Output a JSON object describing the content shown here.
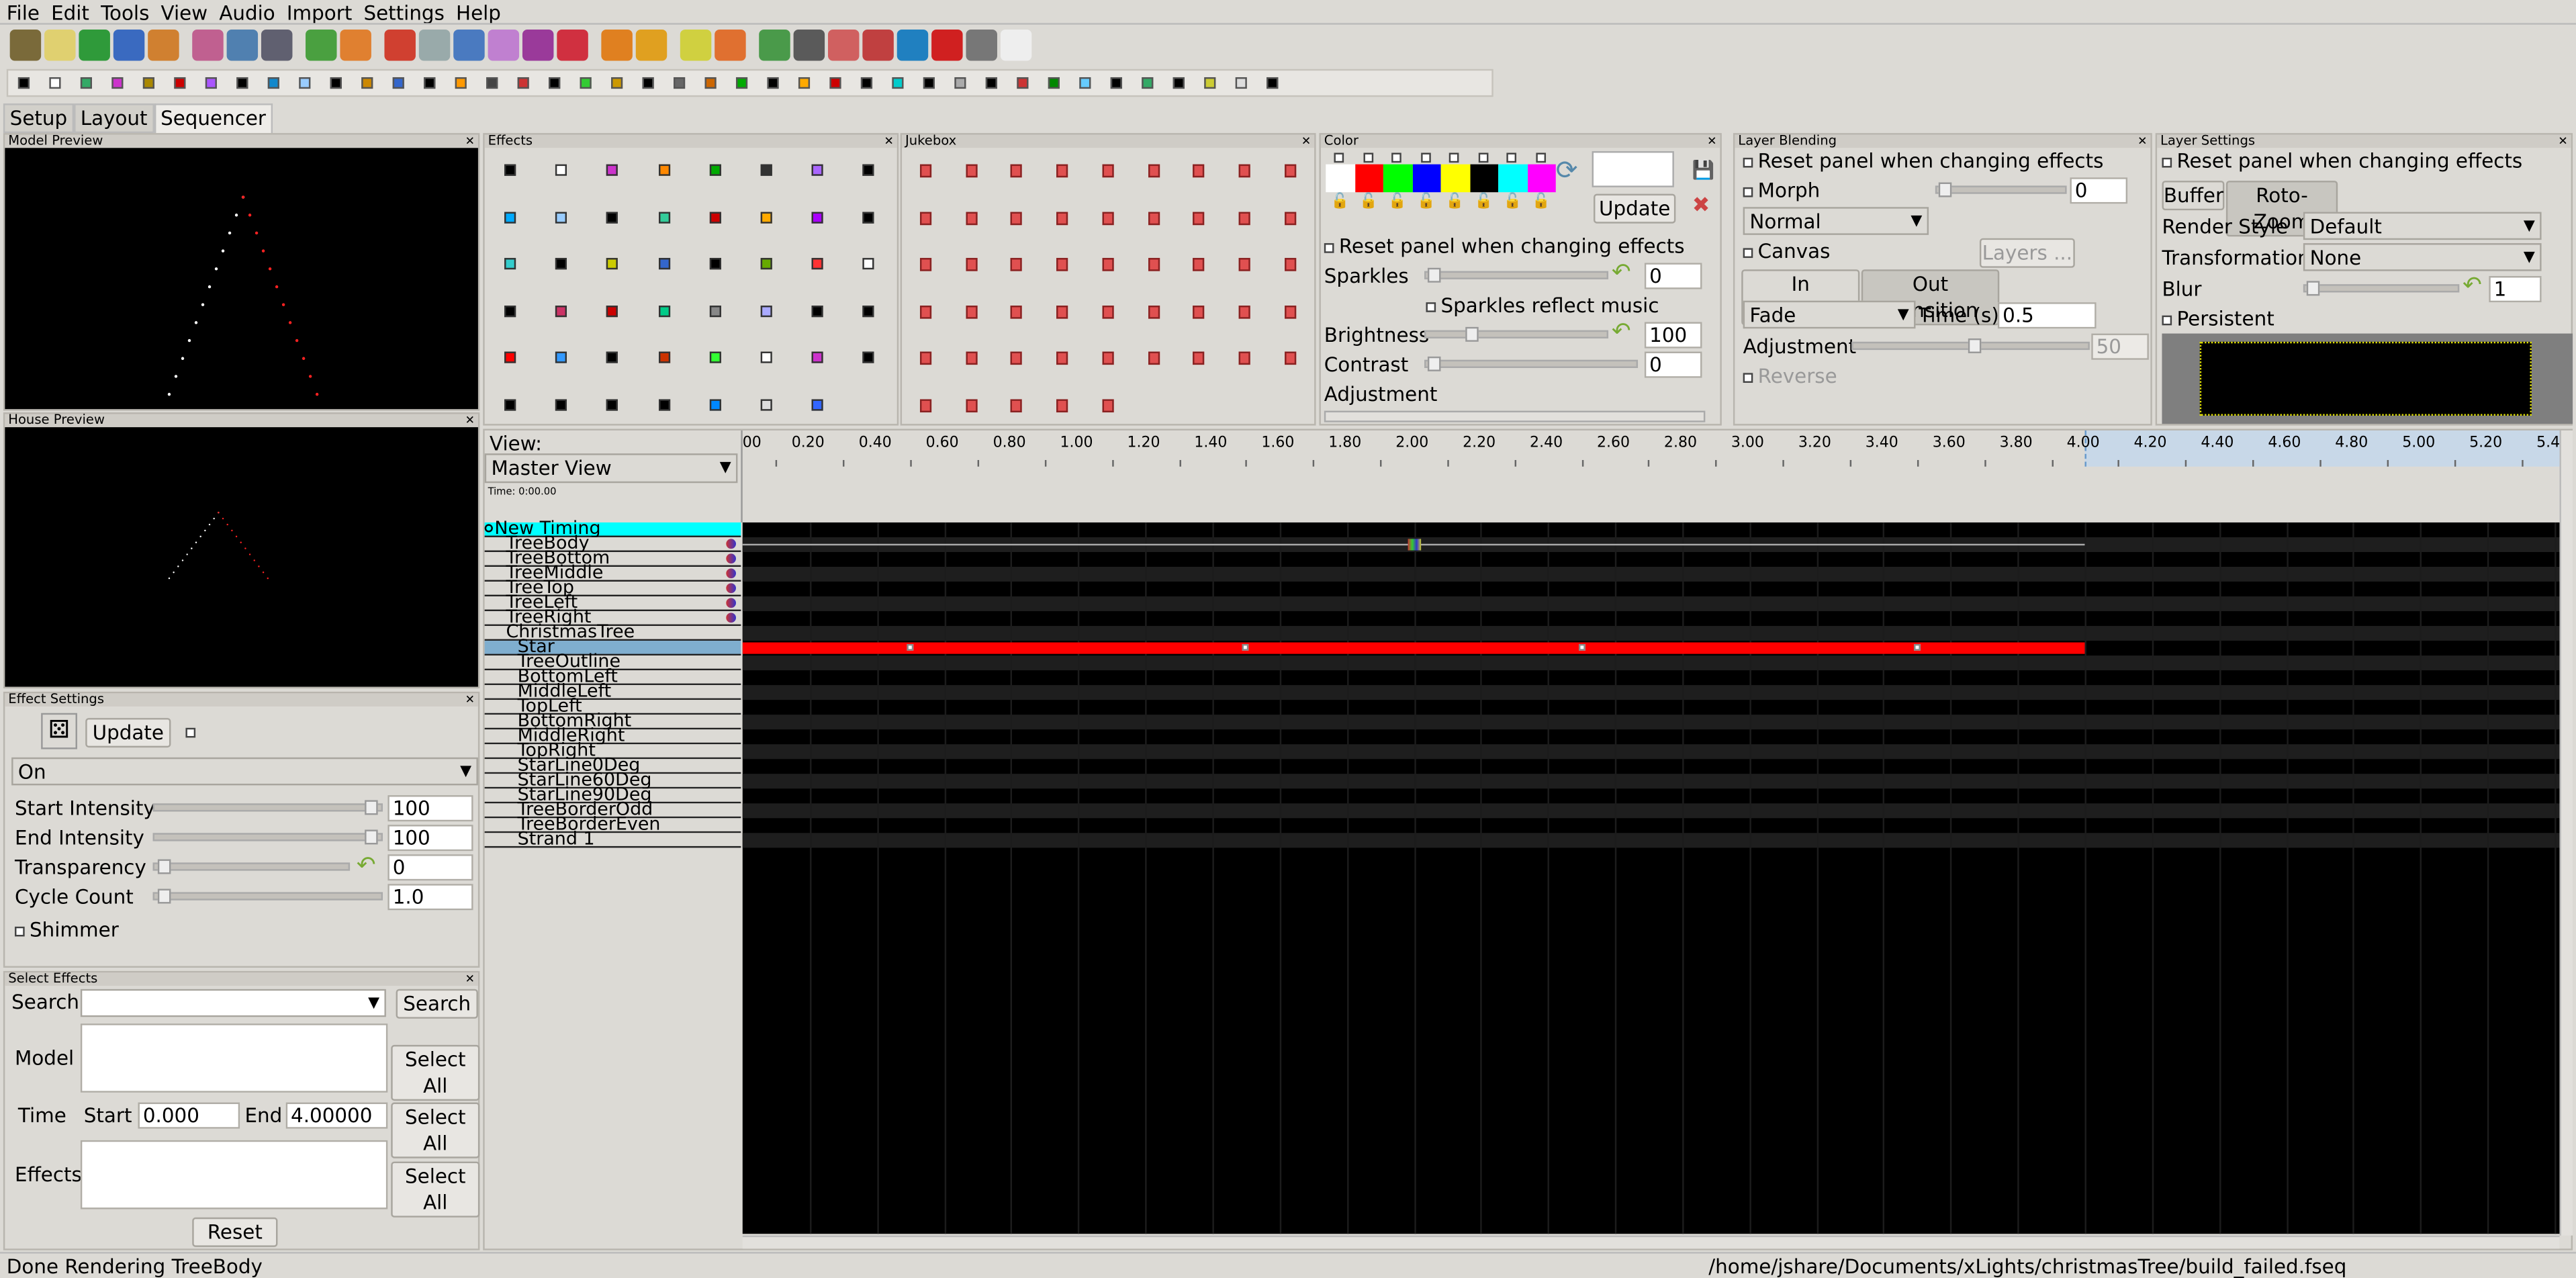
{
  "menu": [
    "File",
    "Edit",
    "Tools",
    "View",
    "Audio",
    "Import",
    "Settings",
    "Help"
  ],
  "tabs": [
    "Setup",
    "Layout",
    "Sequencer"
  ],
  "active_tab": "Sequencer",
  "toolbar_icon_colors": [
    "#7a6a3a",
    "#e0d070",
    "#2f9a3a",
    "#3a6ac0",
    "#d08030",
    "#c06090",
    "#5080b0",
    "#606070",
    "#4aa040",
    "#e08030",
    "#d04030",
    "#9aa",
    "#4a7ac0",
    "#c080d0",
    "#9a3a9a",
    "#d03040",
    "#e08020",
    "#e0a020",
    "#d0d040",
    "#e07030",
    "#4a9a4a",
    "#5a5a5a",
    "#d06060",
    "#c04040",
    "#2080c0",
    "#d02020",
    "#777",
    "#eee"
  ],
  "panels": {
    "model_preview": "Model Preview",
    "house_preview": "House Preview",
    "effects": "Effects",
    "jukebox": "Jukebox",
    "color": "Color",
    "layer_blending": "Layer Blending",
    "layer_settings": "Layer Settings",
    "effect_settings": "Effect Settings",
    "select_effects": "Select Effects"
  },
  "color": {
    "swatches": [
      "#ffffff",
      "#ff0000",
      "#00ff00",
      "#0000ff",
      "#ffff00",
      "#000000",
      "#00ffff",
      "#ff00ff"
    ],
    "update": "Update",
    "reset_panel": "Reset panel when changing effects",
    "sparkles": "Sparkles",
    "sparkles_value": "0",
    "sparkles_reflect": "Sparkles reflect music",
    "brightness": "Brightness",
    "brightness_value": "100",
    "contrast": "Contrast",
    "contrast_value": "0",
    "adjustment": "Adjustment"
  },
  "blending": {
    "reset_panel": "Reset panel when changing effects",
    "morph": "Morph",
    "morph_value": "0",
    "mode": "Normal",
    "canvas": "Canvas",
    "layers": "Layers ...",
    "in_transition": "In Transition",
    "out_transition": "Out Transition",
    "transition": "Fade",
    "time_label": "Time (s)",
    "time_value": "0.5",
    "adjustment": "Adjustment",
    "adjustment_value": "50",
    "reverse": "Reverse"
  },
  "layer_settings": {
    "reset_panel": "Reset panel when changing effects",
    "buffer_tab": "Buffer",
    "rotozoom_tab": "Roto-Zoom",
    "render_style_label": "Render Style",
    "render_style": "Default",
    "transformation_label": "Transformation",
    "transformation": "None",
    "blur_label": "Blur",
    "blur_value": "1",
    "persistent": "Persistent"
  },
  "effect_settings": {
    "update": "Update",
    "effect": "On",
    "start_intensity": "Start Intensity",
    "start_intensity_value": "100",
    "end_intensity": "End Intensity",
    "end_intensity_value": "100",
    "transparency": "Transparency",
    "transparency_value": "0",
    "cycle_count": "Cycle Count",
    "cycle_count_value": "1.0",
    "shimmer": "Shimmer"
  },
  "select_effects": {
    "search_label": "Search",
    "search_value": "",
    "search_button": "Search",
    "model_label": "Model",
    "select_all": "Select All",
    "time_label": "Time",
    "start_label": "Start",
    "start_value": "0.000",
    "end_label": "End",
    "end_value": "4.00000",
    "effects_label": "Effects",
    "reset": "Reset"
  },
  "sequencer": {
    "view_label": "View:",
    "view": "Master View",
    "time": "Time: 0:00.00",
    "ruler": [
      "00",
      "0.20",
      "0.40",
      "0.60",
      "0.80",
      "1.00",
      "1.20",
      "1.40",
      "1.60",
      "1.80",
      "2.00",
      "2.20",
      "2.40",
      "2.60",
      "2.80",
      "3.00",
      "3.20",
      "3.40",
      "3.60",
      "3.80",
      "4.00",
      "4.20",
      "4.40",
      "4.60",
      "4.80",
      "5.00",
      "5.20",
      "5.4"
    ],
    "rows": [
      {
        "name": "New Timing",
        "level": 0,
        "timing": true
      },
      {
        "name": "TreeBody",
        "level": 1,
        "icon": true
      },
      {
        "name": "TreeBottom",
        "level": 1,
        "icon": true
      },
      {
        "name": "TreeMiddle",
        "level": 1,
        "icon": true
      },
      {
        "name": "TreeTop",
        "level": 1,
        "icon": true
      },
      {
        "name": "TreeLeft",
        "level": 1,
        "icon": true
      },
      {
        "name": "TreeRight",
        "level": 1,
        "icon": true
      },
      {
        "name": "ChristmasTree",
        "level": 1
      },
      {
        "name": "Star",
        "level": 2,
        "selected": true
      },
      {
        "name": "TreeOutline",
        "level": 2
      },
      {
        "name": "BottomLeft",
        "level": 2
      },
      {
        "name": "MiddleLeft",
        "level": 2
      },
      {
        "name": "TopLeft",
        "level": 2
      },
      {
        "name": "BottomRight",
        "level": 2
      },
      {
        "name": "MiddleRight",
        "level": 2
      },
      {
        "name": "TopRight",
        "level": 2
      },
      {
        "name": "StarLine0Deg",
        "level": 2
      },
      {
        "name": "StarLine60Deg",
        "level": 2
      },
      {
        "name": "StarLine90Deg",
        "level": 2
      },
      {
        "name": "TreeBorderOdd",
        "level": 2
      },
      {
        "name": "TreeBorderEven",
        "level": 2
      },
      {
        "name": "Strand 1",
        "level": 2
      }
    ],
    "effects": [
      {
        "row": "Star",
        "start": 0.0,
        "end": 4.0,
        "color": "#ff0000"
      },
      {
        "row": "TreeBody",
        "start": 0.0,
        "end": 4.0,
        "marker": 2.0
      }
    ],
    "selection_end": 4.0
  },
  "status": {
    "left": "Done Rendering TreeBody",
    "right": "/home/jshare/Documents/xLights/christmasTree/build_failed.fseq"
  }
}
